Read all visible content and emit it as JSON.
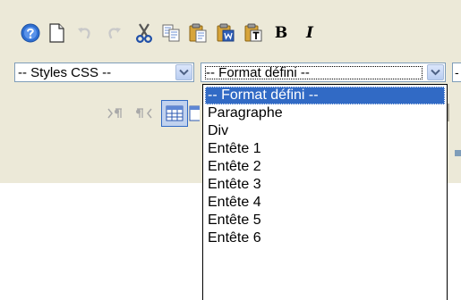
{
  "toolbar": {
    "buttons": [
      {
        "name": "help-icon"
      },
      {
        "name": "new-page-icon"
      },
      {
        "name": "undo-icon"
      },
      {
        "name": "redo-icon"
      },
      {
        "name": "cut-icon"
      },
      {
        "name": "copy-icon"
      },
      {
        "name": "paste-icon"
      },
      {
        "name": "paste-from-word-icon"
      },
      {
        "name": "paste-as-text-icon"
      },
      {
        "name": "bold-icon"
      },
      {
        "name": "italic-icon"
      }
    ],
    "bold_label": "B",
    "italic_label": "I"
  },
  "styles_select": {
    "value": "-- Styles CSS --"
  },
  "format_select": {
    "value": "-- Format défini --",
    "options": [
      "-- Format défini --",
      "Paragraphe",
      "Div",
      "Entête 1",
      "Entête 2",
      "Entête 3",
      "Entête 4",
      "Entête 5",
      "Entête 6"
    ],
    "selected_index": 0
  },
  "next_select": {
    "value": "-"
  },
  "colors": {
    "toolbar_background": "#ece9d8",
    "selection_highlight": "#316ac5",
    "select_border": "#7f9db9"
  }
}
